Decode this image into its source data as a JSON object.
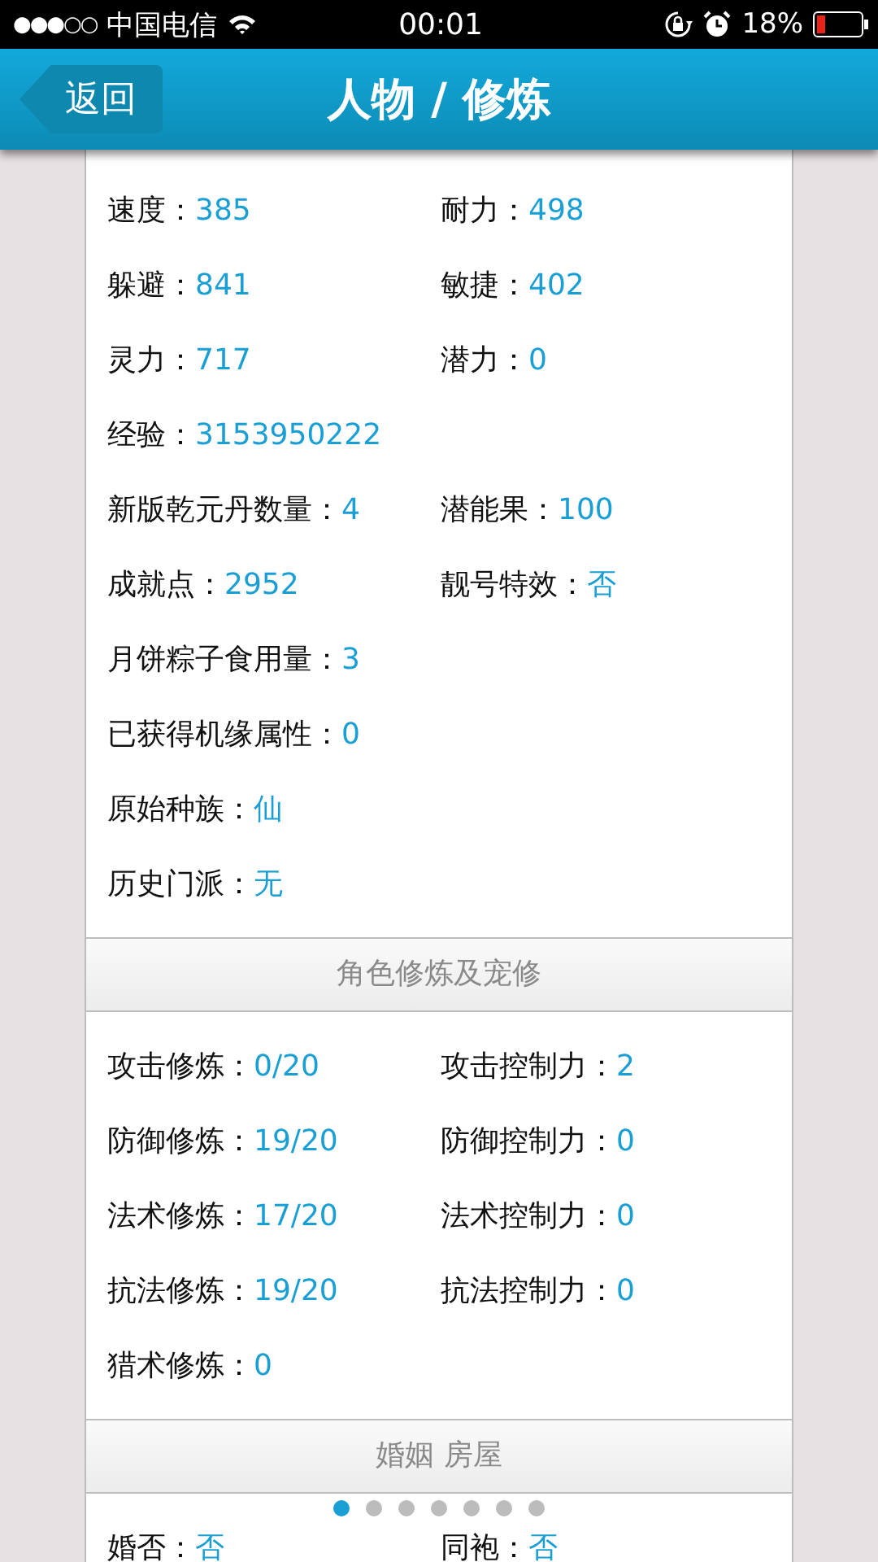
{
  "status_bar": {
    "signal": "●●●○○",
    "carrier": "中国电信",
    "time": "00:01",
    "battery_percent": "18%"
  },
  "header": {
    "back": "返回",
    "title": "人物 / 修炼"
  },
  "sections": [
    {
      "rows": [
        [
          {
            "label": "速度：",
            "value": "385"
          },
          {
            "label": "耐力：",
            "value": "498"
          }
        ],
        [
          {
            "label": "躲避：",
            "value": "841"
          },
          {
            "label": "敏捷：",
            "value": "402"
          }
        ],
        [
          {
            "label": "灵力：",
            "value": "717"
          },
          {
            "label": "潜力：",
            "value": "0"
          }
        ],
        [
          {
            "label": "经验：",
            "value": "3153950222"
          }
        ],
        [
          {
            "label": "新版乾元丹数量：",
            "value": "4"
          },
          {
            "label": "潜能果：",
            "value": "100"
          }
        ],
        [
          {
            "label": "成就点：",
            "value": "2952"
          },
          {
            "label": "靓号特效：",
            "value": "否"
          }
        ],
        [
          {
            "label": "月饼粽子食用量：",
            "value": "3"
          }
        ],
        [
          {
            "label": "已获得机缘属性：",
            "value": "0"
          }
        ],
        [
          {
            "label": "原始种族：",
            "value": "仙"
          }
        ],
        [
          {
            "label": "历史门派：",
            "value": "无"
          }
        ]
      ]
    },
    {
      "heading": "角色修炼及宠修",
      "rows": [
        [
          {
            "label": "攻击修炼：",
            "value": "0/20"
          },
          {
            "label": "攻击控制力：",
            "value": "2"
          }
        ],
        [
          {
            "label": "防御修炼：",
            "value": "19/20"
          },
          {
            "label": "防御控制力：",
            "value": "0"
          }
        ],
        [
          {
            "label": "法术修炼：",
            "value": "17/20"
          },
          {
            "label": "法术控制力：",
            "value": "0"
          }
        ],
        [
          {
            "label": "抗法修炼：",
            "value": "19/20"
          },
          {
            "label": "抗法控制力：",
            "value": "0"
          }
        ],
        [
          {
            "label": "猎术修炼：",
            "value": "0"
          }
        ]
      ]
    },
    {
      "heading": "婚姻 房屋",
      "rows": [
        [
          {
            "label": "婚否：",
            "value": "否"
          },
          {
            "label": "同袍：",
            "value": "否"
          }
        ]
      ]
    }
  ],
  "page_dots": [
    {
      "selected": true
    },
    {
      "selected": false
    },
    {
      "selected": false
    },
    {
      "selected": false
    },
    {
      "selected": false
    },
    {
      "selected": false
    },
    {
      "selected": false
    }
  ]
}
